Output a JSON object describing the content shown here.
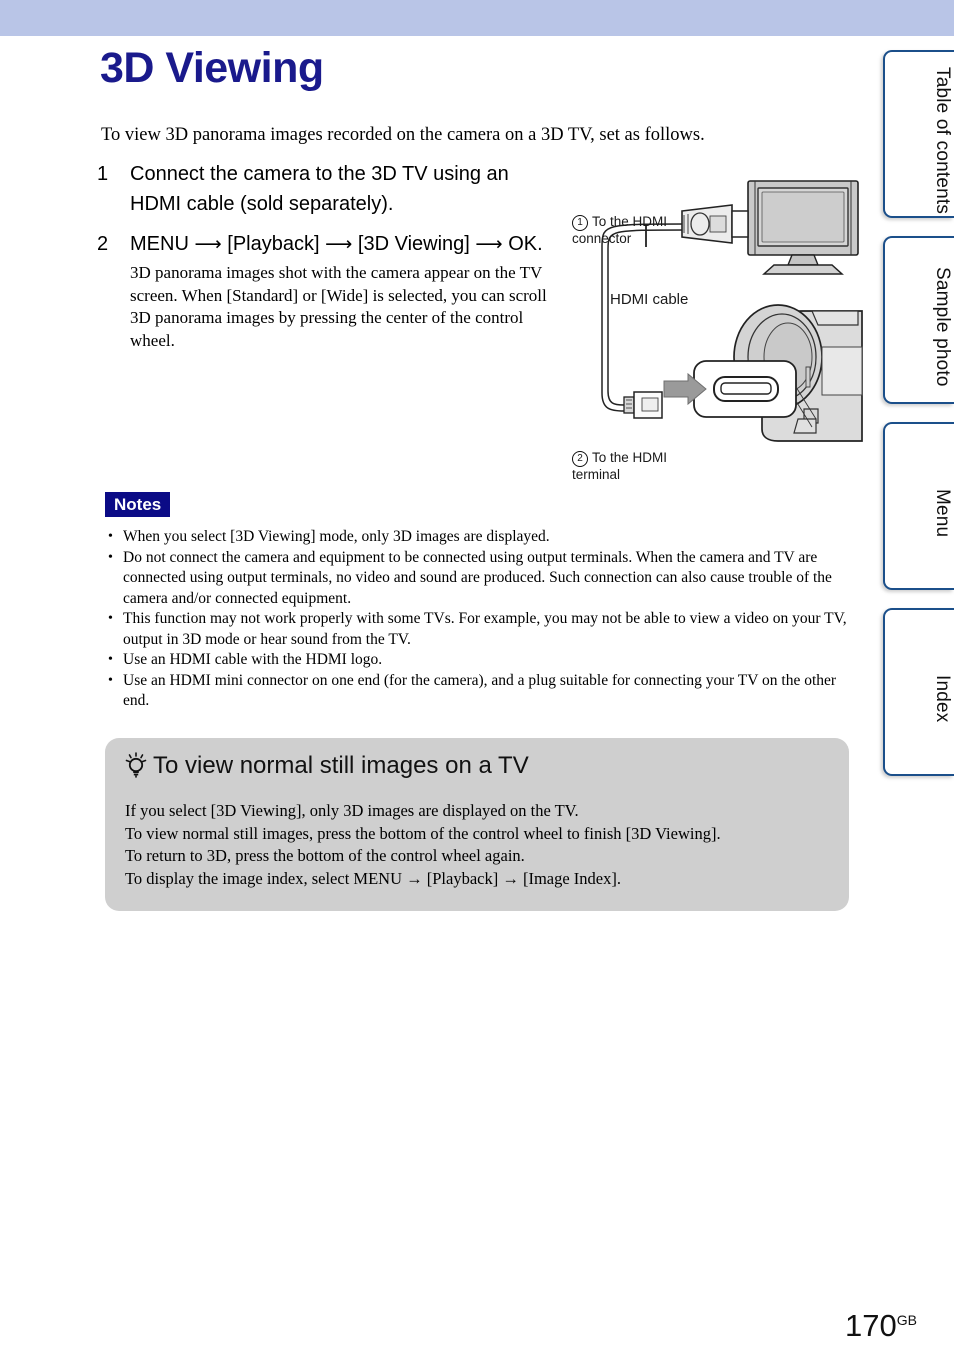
{
  "banner": {
    "color": "#b9c5e7"
  },
  "page": {
    "title": "3D Viewing",
    "title_color": "#1a1a8c",
    "intro": "To view 3D panorama images recorded on the camera on a 3D TV, set as follows.",
    "number": "170",
    "number_suffix": "GB"
  },
  "steps": [
    {
      "num": "1",
      "heading": "Connect the camera to the 3D TV using an HDMI cable (sold separately).",
      "sub": ""
    },
    {
      "num": "2",
      "heading_parts": [
        "MENU",
        "[Playback]",
        "[3D Viewing]",
        "OK."
      ],
      "heading": "MENU → [Playback] → [3D Viewing] → OK.",
      "sub": "3D panorama images shot with the camera appear on the TV screen.\nWhen [Standard] or [Wide] is selected, you can scroll 3D panorama images by pressing the center of the control wheel."
    }
  ],
  "diagram": {
    "callout1_number": "1",
    "callout1_label": "To the HDMI\nconnector",
    "cable_label": "HDMI cable",
    "callout2_number": "2",
    "callout2_label": "To the HDMI\nterminal",
    "devices": [
      "flat-panel-tv",
      "hdmi-connector-plug",
      "camera-body",
      "hdmi-terminal-closeup"
    ]
  },
  "notes": {
    "badge": "Notes",
    "badge_bg": "#0b0b86",
    "items": [
      "When you select [3D Viewing] mode, only 3D images are displayed.",
      "Do not connect the camera and equipment to be connected using output terminals. When the camera and TV are connected using output terminals, no video and sound are produced. Such connection can also cause trouble of the camera and/or connected equipment.",
      "This function may not work properly with some TVs. For example, you may not be able to view a video on your TV, output in 3D mode or hear sound from the TV.",
      "Use an HDMI cable with the HDMI logo.",
      "Use an HDMI mini connector on one end (for the camera), and a plug suitable for connecting your TV on the other end."
    ]
  },
  "tip": {
    "icon": "lightbulb-icon",
    "heading": "To view normal still images on a TV",
    "bg_color": "#cfcfcf",
    "lines": [
      "If you select [3D Viewing], only 3D images are displayed on the TV.",
      "To view normal still images, press the bottom of the control wheel to finish [3D Viewing].",
      "To return to 3D, press the bottom of the control wheel again.",
      "To display the image index, select MENU → [Playback] → [Image Index]."
    ]
  },
  "side_tabs": [
    {
      "label": "Table of\ncontents"
    },
    {
      "label": "Sample photo"
    },
    {
      "label": "Menu"
    },
    {
      "label": "Index"
    }
  ]
}
